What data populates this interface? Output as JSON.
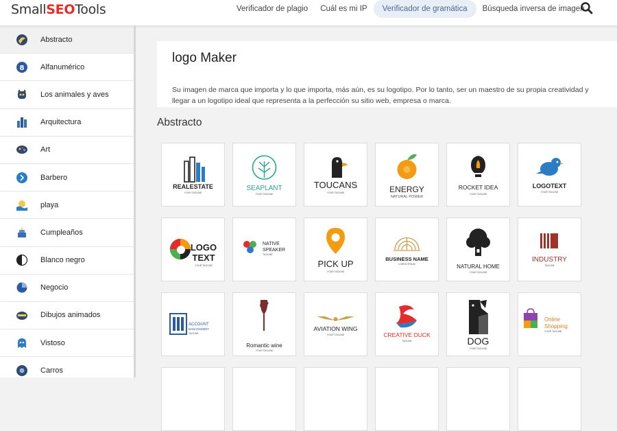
{
  "header": {
    "logo_small": "Small",
    "logo_seo": "SEO",
    "logo_tools": "Tools",
    "nav": [
      {
        "label": "Verificador de plagio"
      },
      {
        "label": "Cuál es mi IP"
      },
      {
        "label": "Verificador de gramática",
        "active": true
      },
      {
        "label": "Búsqueda inversa de imagen"
      }
    ]
  },
  "sidebar": {
    "items": [
      {
        "label": "Abstracto",
        "icon": "abstract-icon",
        "active": true
      },
      {
        "label": "Alfanumérico",
        "icon": "alphanumeric-icon"
      },
      {
        "label": "Los animales y aves",
        "icon": "animals-icon"
      },
      {
        "label": "Arquitectura",
        "icon": "architecture-icon"
      },
      {
        "label": "Art",
        "icon": "art-icon"
      },
      {
        "label": "Barbero",
        "icon": "barber-icon"
      },
      {
        "label": "playa",
        "icon": "beach-icon"
      },
      {
        "label": "Cumpleaños",
        "icon": "birthday-icon"
      },
      {
        "label": "Blanco negro",
        "icon": "black-white-icon"
      },
      {
        "label": "Negocio",
        "icon": "business-icon"
      },
      {
        "label": "Dibujos animados",
        "icon": "cartoon-icon"
      },
      {
        "label": "Vistoso",
        "icon": "colorful-icon"
      },
      {
        "label": "Carros",
        "icon": "cars-icon"
      }
    ]
  },
  "intro": {
    "title": "logo Maker",
    "description": "Su imagen de marca que importa y lo que importa, más aún, es su logotipo. Por lo tanto, ser un maestro de su propia creatividad y llegar a un logotipo ideal que representa a la perfección su sitio web, empresa o marca."
  },
  "section": {
    "title": "Abstracto"
  },
  "logos": [
    {
      "name": "REALESTATE",
      "tagline": "YOUR TAGLINE"
    },
    {
      "name": "SEAPLANT",
      "tagline": "YOUR TAGLINE"
    },
    {
      "name": "TOUCANS",
      "tagline": "YOUR TAGLINE"
    },
    {
      "name": "ENERGY",
      "tagline": "NATURAL POWER"
    },
    {
      "name": "ROCKET IDEA",
      "tagline": "YOUR TAGLINE"
    },
    {
      "name": "LOGOTEXT",
      "tagline": "YOUR TAGLINE"
    },
    {
      "name": "LOGO TEXT",
      "tagline": "YOUR TAGLINE"
    },
    {
      "name": "NATIVE SPEAKER",
      "tagline": "TAGLINE"
    },
    {
      "name": "PICK UP",
      "tagline": "YOUR TAGLINE"
    },
    {
      "name": "BUSINESS NAME",
      "tagline": "LOREM IPSUM"
    },
    {
      "name": "NATURAL HOME",
      "tagline": "YOUR TAGLINE"
    },
    {
      "name": "INDUSTRY",
      "tagline": "TAGLINE"
    },
    {
      "name": "ACCOUNT MANAGEMENT",
      "tagline": "TAGLINE"
    },
    {
      "name": "Romantic wine",
      "tagline": "YOUR TAGLINE"
    },
    {
      "name": "AVIATION WING",
      "tagline": "YOUR TAGLINE"
    },
    {
      "name": "CREATIVE DUCK",
      "tagline": "TAGLINE"
    },
    {
      "name": "DOG",
      "tagline": "YOUR TAGLINE"
    },
    {
      "name": "Online Shopping",
      "tagline": "YOUR TAGLINE"
    }
  ],
  "colors": {
    "accent": "#e62b2b",
    "nav_active_bg": "#e8eef6",
    "nav_active_text": "#4a6a98"
  }
}
